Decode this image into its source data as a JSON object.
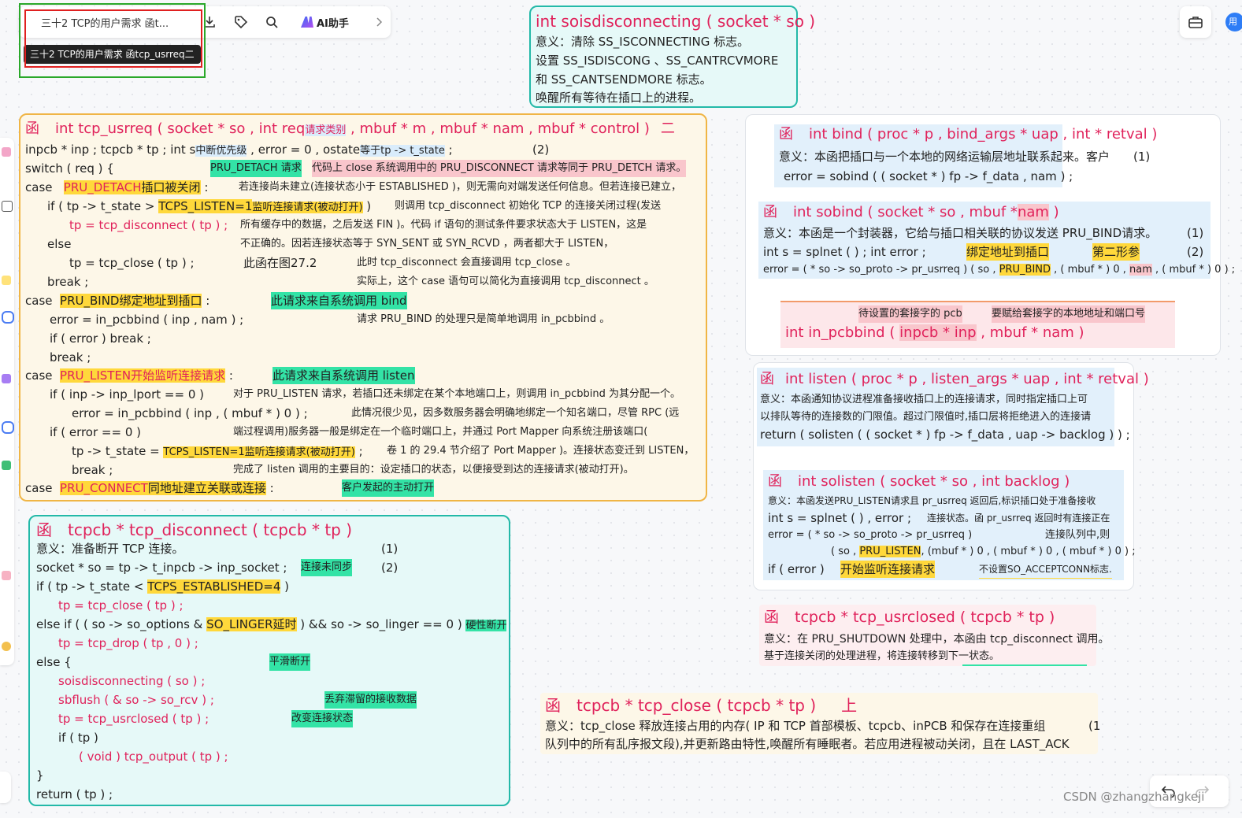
{
  "toolbar": {
    "doc_title": "三十2 TCP的用户需求 函t...",
    "tooltip": "三十2 TCP的用户需求 函tcp_usrreq二",
    "ai_label": "AI助手",
    "icons": [
      "download-icon",
      "tag-icon",
      "search-icon",
      "ai-icon",
      "chevron-right-icon"
    ]
  },
  "top_right": {
    "avatar": "用",
    "icons": [
      "briefcase-icon"
    ]
  },
  "watermark": "CSDN @zhangzhangkeji",
  "soisdisconnecting": {
    "title": "int soisdisconnecting ( socket * so )",
    "lines": [
      "意义：清除 SS_ISCONNECTING 标志。",
      "设置 SS_ISDISCONG 、SS_CANTRCVMORE",
      "和 SS_CANTSENDMORE 标志。",
      "唤醒所有等待在插口上的进程。"
    ]
  },
  "usrreq": {
    "fn": "函",
    "sig_a": "int  tcp_usrreq ( socket * so ,  int  req",
    "sig_b": "请求类别",
    "sig_c": " , mbuf * m ,  mbuf * nam , mbuf *  control )",
    "sig_d": "二",
    "l1a": "inpcb * inp ;      tcpcb * tp ;      int  s",
    "l1b": "中断优先级",
    "l1c": " , error  =  0 , ostate",
    "l1d": "等于tp -> t_state",
    "l1e": " ;",
    "l1n": "(2)",
    "l2a": "switch ( req ) {",
    "l2b": "PRU_DETACH 请求",
    "l2c": "代码上 close 系统调用中的 PRU_DISCONNECT 请求等同于 PRU_DETCH 请求。",
    "c1a": "case",
    "c1b": "PRU_DETACH",
    "c1c": "插口被关闭",
    "c1d": " :",
    "c1t": "若连接尚未建立(连接状态小于 ESTABLISHED )，则无需向对端发送任何信息。但若连接已建立，",
    "c2a": "if ( tp -> t_state  >",
    "c2b": "TCPS_LISTEN=1",
    "c2c": "监听连接请求(被动打开)",
    "c2d": " )",
    "c2t": "则调用 tcp_disconnect 初始化 TCP 的连接关闭过程(发送",
    "c3a": "tp  =  tcp_disconnect ( tp ) ;",
    "c3t": "所有缓存中的数据，之后发送 FIN )。代码 if 语句的测试条件要求状态大于 LISTEN，这是",
    "c4a": "else",
    "c4t": "不正确的。因若连接状态等于 SYN_SENT 或 SYN_RCVD ，两者都大于 LISTEN，",
    "c5a": "tp  =  tcp_close ( tp ) ;",
    "c5b": "此函在图27.2",
    "c5t": "此时 tcp_disconnect 会直接调用 tcp_close 。",
    "c6a": "break ;",
    "c6t": "实际上，这个 case 语句可以简化为直接调用 tcp_disconnect 。",
    "b1a": "case",
    "b1b": "PRU_BIND绑定地址到插口",
    "b1c": " :",
    "b1d": "此请求来自系统调用 bind",
    "b2a": "error  =  in_pcbbind ( inp , nam ) ;",
    "b2t": "请求 PRU_BIND 的处理只是简单地调用 in_pcbbind 。",
    "b3a": "if ( error )      break ;",
    "b4a": "break ;",
    "s1a": "case",
    "s1b": "PRU_LISTEN开始监听连接请求",
    "s1c": " :",
    "s1d": "此请求来自系统调用 listen",
    "s2a": "if ( inp -> inp_lport  ==  0 )",
    "s2t": "对于 PRU_LISTEN 请求，若插口还未绑定在某个本地端口上，则调用 in_pcbbind 为其分配一个。",
    "s3a": "error  =  in_pcbbind ( inp , ( mbuf * ) 0 ) ;",
    "s3t": "此情况很少见，因多数服务器会明确地绑定一个知名端口，尽管 RPC (远",
    "s4a": "if ( error  ==  0 )",
    "s4t": "端过程调用)服务器一般是绑定在一个临时端口上，并通过 Port Mapper 向系统注册该端口(",
    "s5a": "tp -> t_state  =",
    "s5b": "TCPS_LISTEN=1监听连接请求(被动打开)",
    "s5c": " ;",
    "s5t": "卷 1 的 29.4 节介绍了 Port Mapper )。连接状态变迁到 LISTEN，",
    "s6a": "break ;",
    "s6t": "完成了 listen 调用的主要目的：设定插口的状态，以便接受到达的连接请求(被动打开)。",
    "k1a": "case",
    "k1b": "PRU_CONNECT",
    "k1c": "同地址建立关联或连接",
    "k1d": " :",
    "k1e": "客户发起的主动打开"
  },
  "bind": {
    "fn": "函",
    "sig": "int  bind ( proc * p , bind_args  * uap , int  * retval )",
    "l1": "意义：本函把插口与一个本地的网络运输层地址联系起来。客户",
    "l1n": "(1)",
    "l2": "error  =  sobind ( ( socket * ) fp -> f_data , nam ) ;"
  },
  "sobind": {
    "fn": "函",
    "sig_a": "int  sobind ( socket * so , mbuf *",
    "sig_b": "nam",
    "sig_c": " )",
    "l1": "意义：本函是一个封装器，它给与插口相关联的协议发送 PRU_BIND请求。",
    "l1n": "(1)",
    "l2a": "int  s  =  splnet ( ) ;      int  error ;",
    "l2b": "绑定地址到插口",
    "l2c": "第二形参",
    "l2n": "(2)",
    "l3a": "error = ( * so -> so_proto -> pr_usrreq ) ( so ,",
    "l3b": "PRU_BIND",
    "l3c": " , ( mbuf * ) 0 ,",
    "l3d": "nam",
    "l3e": " , ( mbuf * ) 0 ) ;"
  },
  "inpcbbind": {
    "n1": "待设置的套接字的 pcb",
    "n2": "要赋给套接字的本地地址和端口号",
    "sig_a": "int  in_pcbbind (",
    "sig_b": "inpcb  *  inp",
    "sig_c": " ,  mbuf  *  nam  )"
  },
  "listen": {
    "fn": "函",
    "sig": "int  listen ( proc * p , listen_args * uap , int * retval )",
    "l1": "意义：本函通知协议进程准备接收插口上的连接请求，同时指定插口上可",
    "l2": "以排队等待的连接数的门限值。超过门限值时,插口层将拒绝进入的连接请",
    "l3": "return  ( solisten ( ( socket * ) fp -> f_data , uap -> backlog ) ) ;"
  },
  "solisten": {
    "fn": "函",
    "sig": "int  solisten ( socket * so ,  int  backlog )",
    "l1": "意义：本函发送PRU_LISTEN请求且 pr_usrreq 返回后,标识插口处于准备接收",
    "l2a": "int  s  =  splnet ( ) ,    error ;",
    "l2b": "连接状态。函 pr_usrreq 返回时有连接正在",
    "l3a": "error  =  ( * so -> so_proto -> pr_usrreq )",
    "l3b": "连接队列中,则",
    "l4a": "( so ,",
    "l4b": "PRU_LISTEN",
    "l4c": ", (mbuf * ) 0 , ( mbuf * ) 0 , ( mbuf * ) 0 ) ;",
    "l5a": "if ( error )",
    "l5b": "开始监听连接请求",
    "l5c": "不设置SO_ACCEPTCONN标志."
  },
  "usrclosed": {
    "fn": "函",
    "sig": "tcpcb *  tcp_usrclosed ( tcpcb * tp )",
    "l1": "意义：在 PRU_SHUTDOWN 处理中，本函由 tcp_disconnect 调用。",
    "l2": "基于连接关闭的处理进程，将连接转移到下一状态。"
  },
  "disconnect": {
    "fn": "函",
    "sig": "tcpcb *  tcp_disconnect ( tcpcb * tp )",
    "l1": "意义：准备断开 TCP 连接。",
    "l1n": "(1)",
    "l2": "socket * so  =  tp -> t_inpcb -> inp_socket ;",
    "l2b": "连接未同步",
    "l2n": "(2)",
    "l3a": "if ( tp -> t_state  <",
    "l3b": "TCPS_ESTABLISHED=4",
    "l3c": " )",
    "l4": "tp  =  tcp_close ( tp ) ;",
    "l5a": "else if ( ( so -> so_options  &",
    "l5b": "SO_LINGER延时",
    "l5c": " )  &&  so -> so_linger  ==  0 )",
    "l5d": "硬性断开",
    "l6": "tp  =  tcp_drop ( tp , 0 ) ;",
    "l7": "else {",
    "l7b": "平滑断开",
    "l8": "soisdisconnecting ( so ) ;",
    "l9": "sbflush ( & so -> so_rcv ) ;",
    "l9b": "丢弃滞留的接收数据",
    "l10": "tp  =  tcp_usrclosed ( tp ) ;",
    "l10b": "改变连接状态",
    "l11": "if ( tp )",
    "l12": "( void ) tcp_output ( tp ) ;",
    "l13": "}",
    "l14": "return  ( tp ) ;"
  },
  "close": {
    "fn": "函",
    "sig": "tcpcb *  tcp_close ( tcpcb * tp )",
    "tag": "上",
    "l1": "意义：tcp_close 释放连接占用的内存( IP 和 TCP 首部模板、tcpcb、inPCB 和保存在连接重组",
    "l1n": "(1",
    "l2": "队列中的所有乱序报文段),并更新路由特性,唤醒所有睡眠者。若应用进程被动关闭，且在 LAST_ACK"
  }
}
